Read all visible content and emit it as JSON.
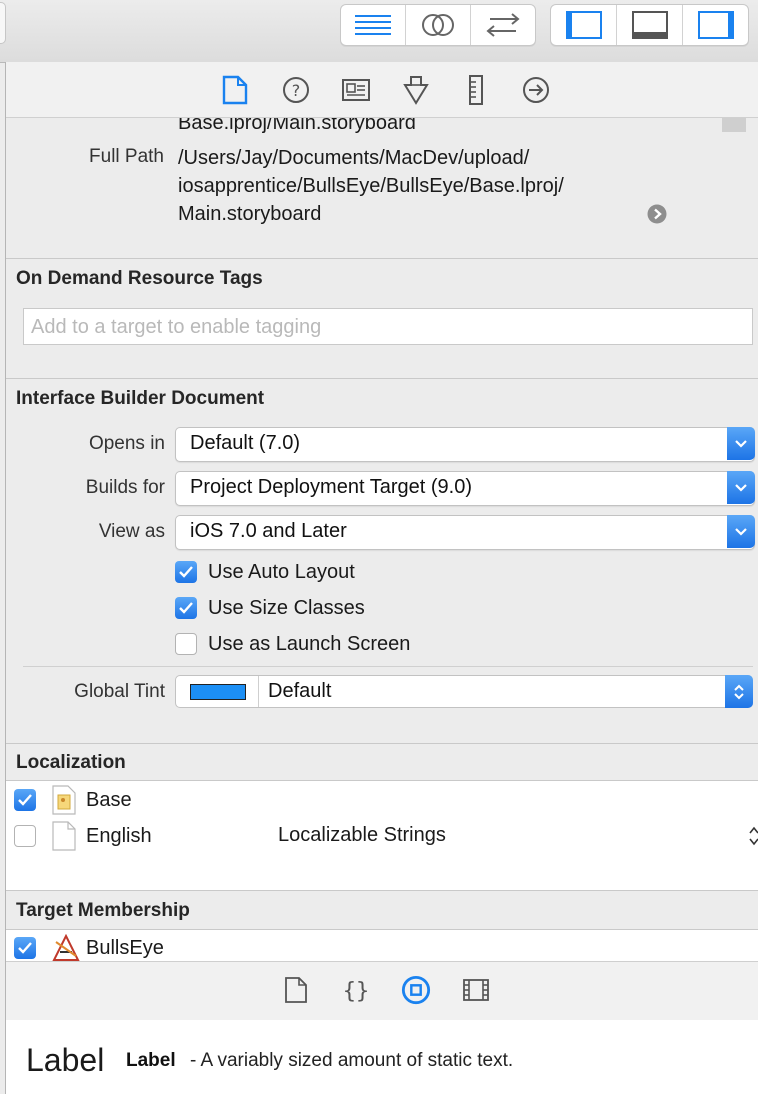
{
  "inspector": {
    "file_location_partial": "Base.lproj/Main.storyboard",
    "full_path_label": "Full Path",
    "full_path_lines": [
      "/Users/Jay/Documents/MacDev/upload/",
      "iosapprentice/BullsEye/BullsEye/Base.lproj/",
      "Main.storyboard"
    ],
    "on_demand": {
      "title": "On Demand Resource Tags",
      "placeholder": "Add to a target to enable tagging"
    },
    "ib_document": {
      "title": "Interface Builder Document",
      "opens_in_label": "Opens in",
      "opens_in_value": "Default (7.0)",
      "builds_for_label": "Builds for",
      "builds_for_value": "Project Deployment Target (9.0)",
      "view_as_label": "View as",
      "view_as_value": "iOS 7.0 and Later",
      "checkboxes": [
        {
          "label": "Use Auto Layout",
          "checked": true
        },
        {
          "label": "Use Size Classes",
          "checked": true
        },
        {
          "label": "Use as Launch Screen",
          "checked": false
        }
      ],
      "global_tint_label": "Global Tint",
      "global_tint_value": "Default",
      "global_tint_color": "#1c8ff5"
    },
    "localization": {
      "title": "Localization",
      "rows": [
        {
          "name": "Base",
          "checked": true,
          "detail": ""
        },
        {
          "name": "English",
          "checked": false,
          "detail": "Localizable Strings"
        }
      ]
    },
    "target_membership": {
      "title": "Target Membership",
      "targets": [
        {
          "name": "BullsEye",
          "checked": true
        }
      ]
    }
  },
  "library": {
    "selected_item_glyph": "Label",
    "selected_item_name": "Label",
    "selected_item_desc": "- A variably sized amount of static text."
  },
  "icons": {
    "toolbar": [
      "standard-editor-icon",
      "assistant-editor-icon",
      "version-editor-icon",
      "navigator-toggle-icon",
      "debug-area-toggle-icon",
      "utilities-toggle-icon"
    ],
    "inspector_tabs": [
      "file-inspector-icon",
      "quick-help-icon",
      "identity-inspector-icon",
      "attributes-inspector-icon",
      "size-inspector-icon",
      "connections-inspector-icon"
    ],
    "library_tabs": [
      "file-template-library-icon",
      "code-snippet-library-icon",
      "object-library-icon",
      "media-library-icon"
    ]
  },
  "colors": {
    "accent": "#1d74e6",
    "active_tab": "#1a82ef"
  }
}
